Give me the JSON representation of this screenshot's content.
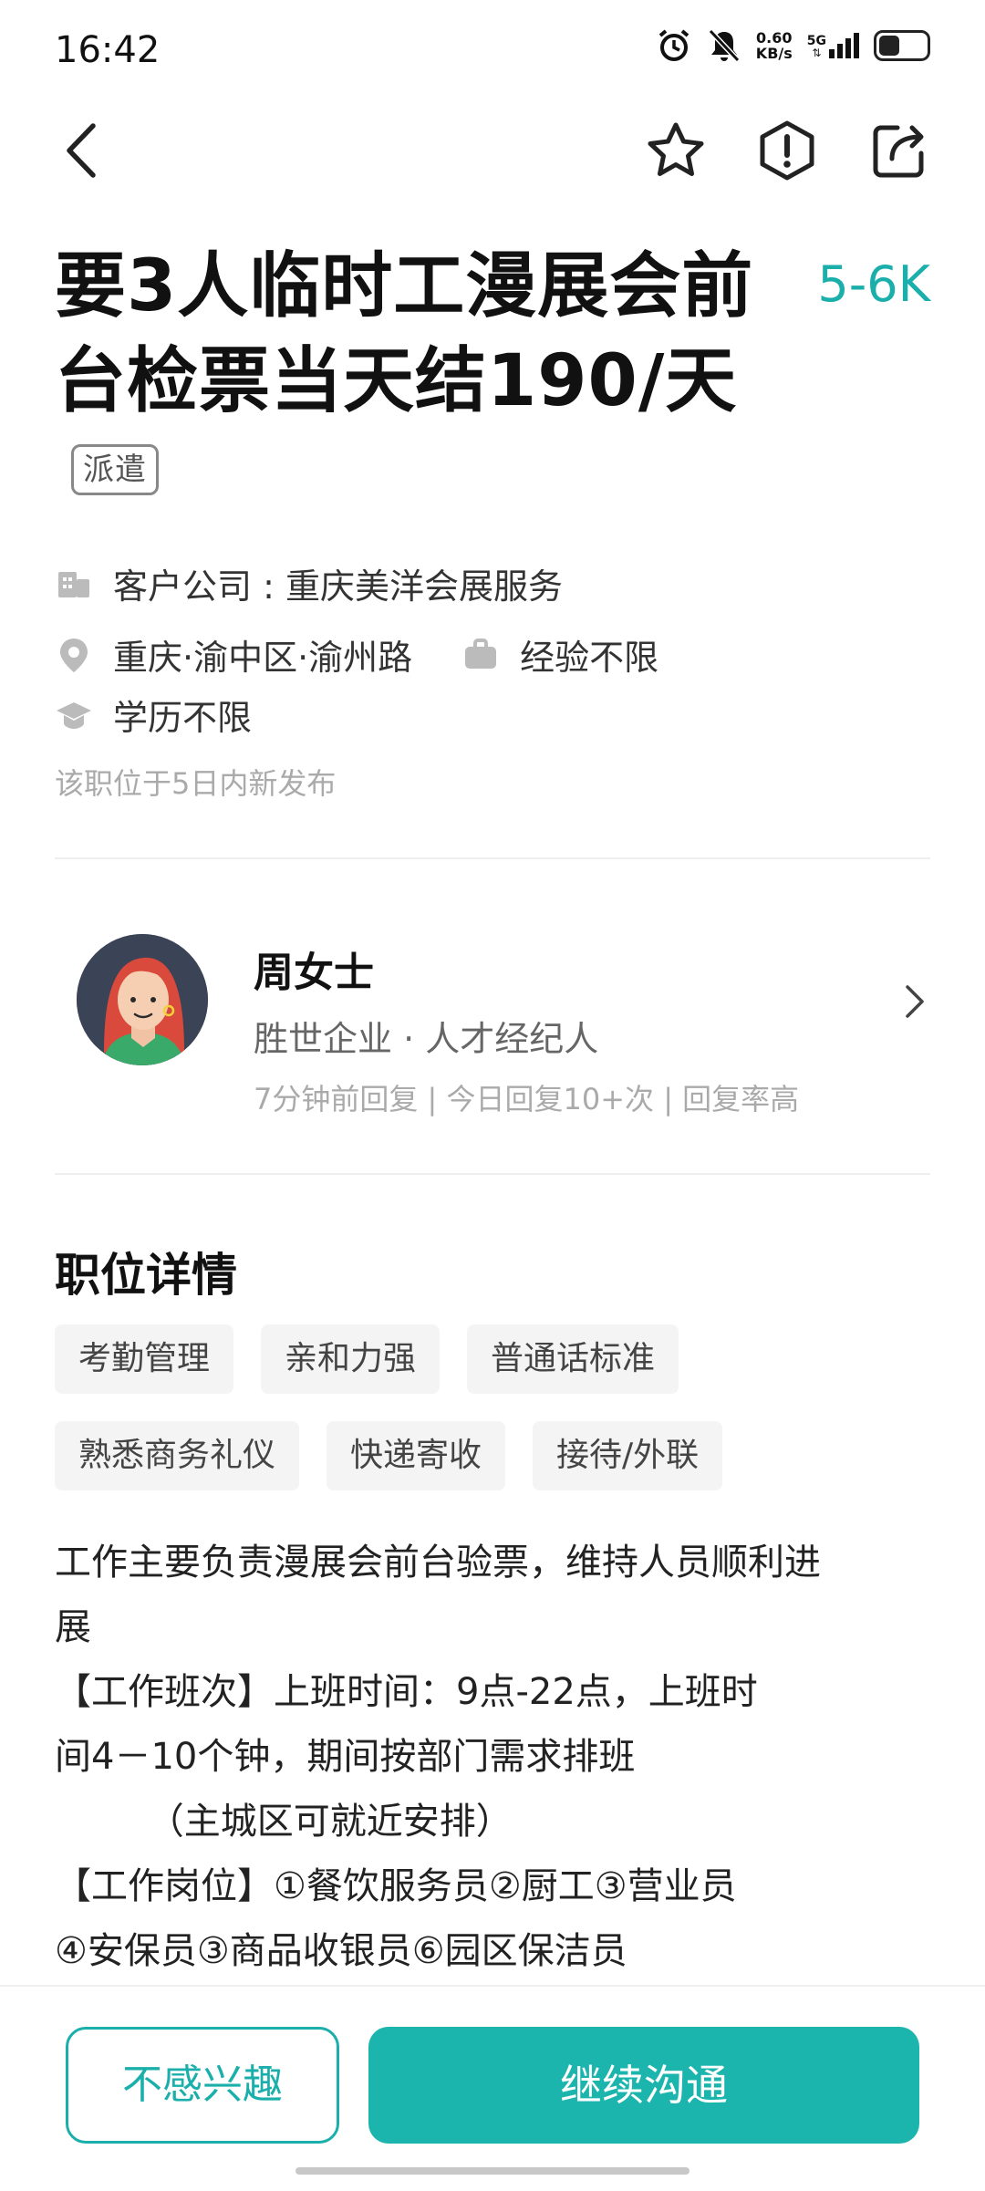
{
  "status_bar": {
    "time": "16:42",
    "net_speed_value": "0.60",
    "net_speed_unit": "KB/s",
    "network_type": "5G",
    "icons": [
      "alarm-icon",
      "mute-icon",
      "signal-icon",
      "battery-icon"
    ]
  },
  "nav": {
    "icons": [
      "back-icon",
      "star-icon",
      "report-icon",
      "share-icon"
    ]
  },
  "job": {
    "title": "要3人临时工漫展会前台检票当天结190/天",
    "tag": "派遣",
    "salary": "5-6K",
    "company": "客户公司 : 重庆美洋会展服务",
    "location": "重庆·渝中区·渝州路",
    "experience": "经验不限",
    "education": "学历不限",
    "posted_note": "该职位于5日内新发布"
  },
  "recruiter": {
    "name": "周女士",
    "company_role": "胜世企业 · 人才经纪人",
    "stats": "7分钟前回复 | 今日回复10+次 | 回复率高"
  },
  "details": {
    "section_title": "职位详情",
    "tags": [
      "考勤管理",
      "亲和力强",
      "普通话标准",
      "熟悉商务礼仪",
      "快递寄收",
      "接待/外联"
    ],
    "description": "工作主要负责漫展会前台验票，维持人员顺利进\n展\n【工作班次】上班时间：9点-22点，上班时\n间4－10个钟，期间按部门需求排班\n        （主城区可就近安排）\n【工作岗位】①餐饮服务员②厨工③营业员\n④安保员③商品收银员⑥园区保洁员"
  },
  "actions": {
    "not_interested": "不感兴趣",
    "continue_chat": "继续沟通"
  },
  "colors": {
    "accent": "#1bb5ad",
    "salary": "#1aafaa"
  }
}
